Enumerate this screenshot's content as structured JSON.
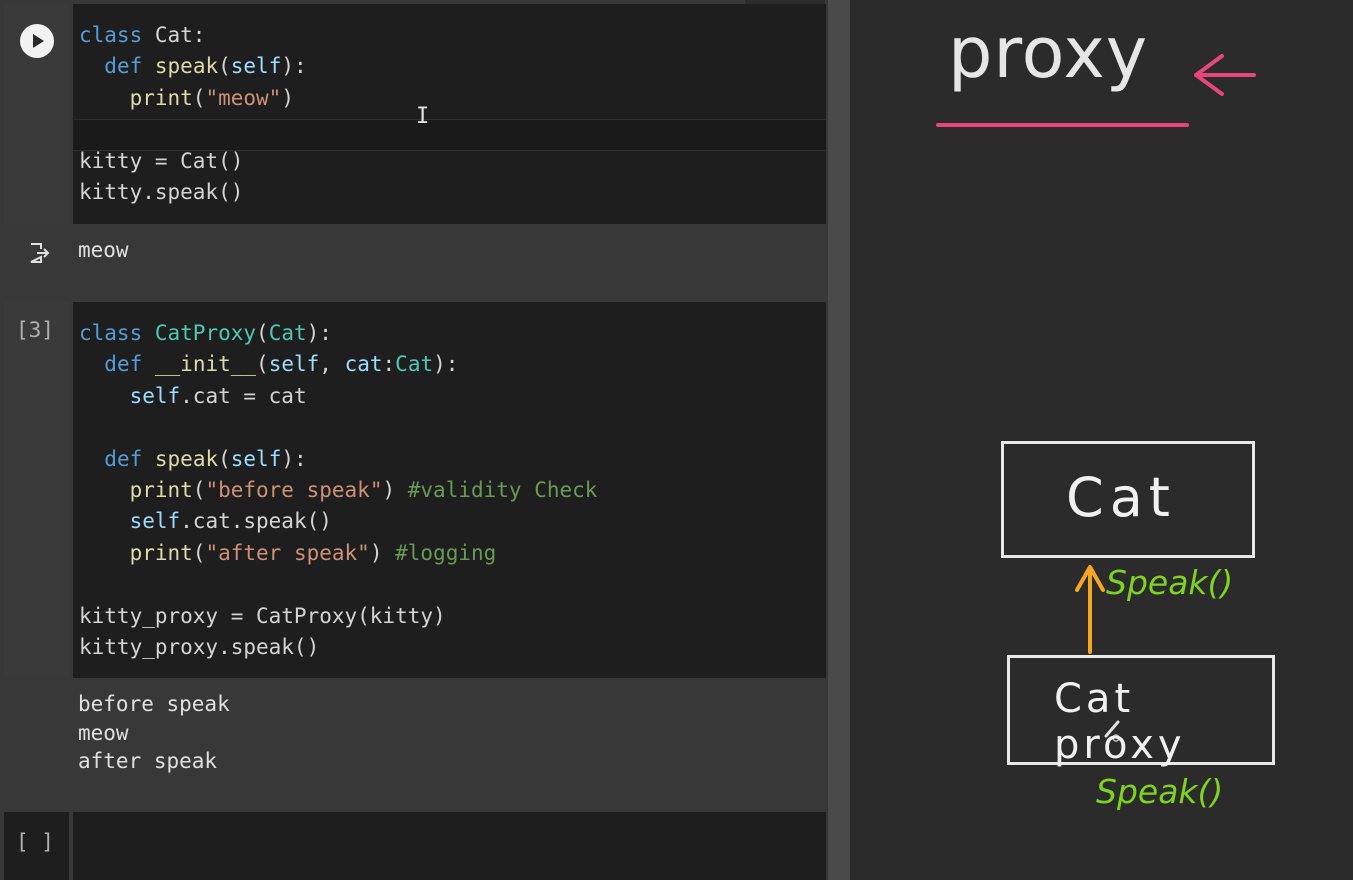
{
  "cell1": {
    "lines": [
      [
        [
          "kw",
          "class"
        ],
        [
          "",
          " Cat:"
        ]
      ],
      [
        [
          "",
          "  "
        ],
        [
          "kw",
          "def"
        ],
        [
          "",
          " "
        ],
        [
          "fn",
          "speak"
        ],
        [
          "",
          "("
        ],
        [
          "sf",
          "self"
        ],
        [
          "",
          "):"
        ]
      ],
      [
        [
          "",
          "    "
        ],
        [
          "fn",
          "print"
        ],
        [
          "",
          "("
        ],
        [
          "st",
          "\"meow\""
        ],
        [
          "",
          ")"
        ]
      ],
      [
        [
          "",
          ""
        ]
      ],
      [
        [
          "",
          "kitty = Cat()"
        ]
      ],
      [
        [
          "",
          "kitty.speak()"
        ]
      ]
    ],
    "output": "meow"
  },
  "cell2": {
    "exec_count": "[3]",
    "lines": [
      [
        [
          "kw",
          "class"
        ],
        [
          "",
          " "
        ],
        [
          "cls",
          "CatProxy"
        ],
        [
          "",
          "("
        ],
        [
          "cls",
          "Cat"
        ],
        [
          "",
          "):"
        ]
      ],
      [
        [
          "",
          "  "
        ],
        [
          "kw",
          "def"
        ],
        [
          "",
          " "
        ],
        [
          "fn",
          "__init__"
        ],
        [
          "",
          "("
        ],
        [
          "sf",
          "self"
        ],
        [
          "",
          ", "
        ],
        [
          "sf",
          "cat"
        ],
        [
          "",
          ":"
        ],
        [
          "cls",
          "Cat"
        ],
        [
          "",
          "):"
        ]
      ],
      [
        [
          "",
          "    "
        ],
        [
          "sf",
          "self"
        ],
        [
          "",
          ".cat = cat"
        ]
      ],
      [
        [
          "",
          ""
        ]
      ],
      [
        [
          "",
          "  "
        ],
        [
          "kw",
          "def"
        ],
        [
          "",
          " "
        ],
        [
          "fn",
          "speak"
        ],
        [
          "",
          "("
        ],
        [
          "sf",
          "self"
        ],
        [
          "",
          "):"
        ]
      ],
      [
        [
          "",
          "    "
        ],
        [
          "fn",
          "print"
        ],
        [
          "",
          "("
        ],
        [
          "st",
          "\"before speak\""
        ],
        [
          "",
          ") "
        ],
        [
          "cm",
          "#validity Check"
        ]
      ],
      [
        [
          "",
          "    "
        ],
        [
          "sf",
          "self"
        ],
        [
          "",
          ".cat.speak()"
        ]
      ],
      [
        [
          "",
          "    "
        ],
        [
          "fn",
          "print"
        ],
        [
          "",
          "("
        ],
        [
          "st",
          "\"after speak\""
        ],
        [
          "",
          ") "
        ],
        [
          "cm",
          "#logging"
        ]
      ],
      [
        [
          "",
          ""
        ]
      ],
      [
        [
          "",
          "kitty_proxy = CatProxy(kitty)"
        ]
      ],
      [
        [
          "",
          "kitty_proxy.speak()"
        ]
      ]
    ],
    "output": "before speak\nmeow\nafter speak"
  },
  "cell3": {
    "exec_count": "[ ]"
  },
  "whiteboard": {
    "title": "proxy",
    "box_top_label": "Cat",
    "box_bottom_label": "Cat proxy",
    "speak_top": "Speak()",
    "speak_bottom": "Speak()"
  },
  "colors": {
    "accent_pink": "#e8457c",
    "arrow_orange": "#f5a623",
    "speak_green": "#7ed321"
  }
}
